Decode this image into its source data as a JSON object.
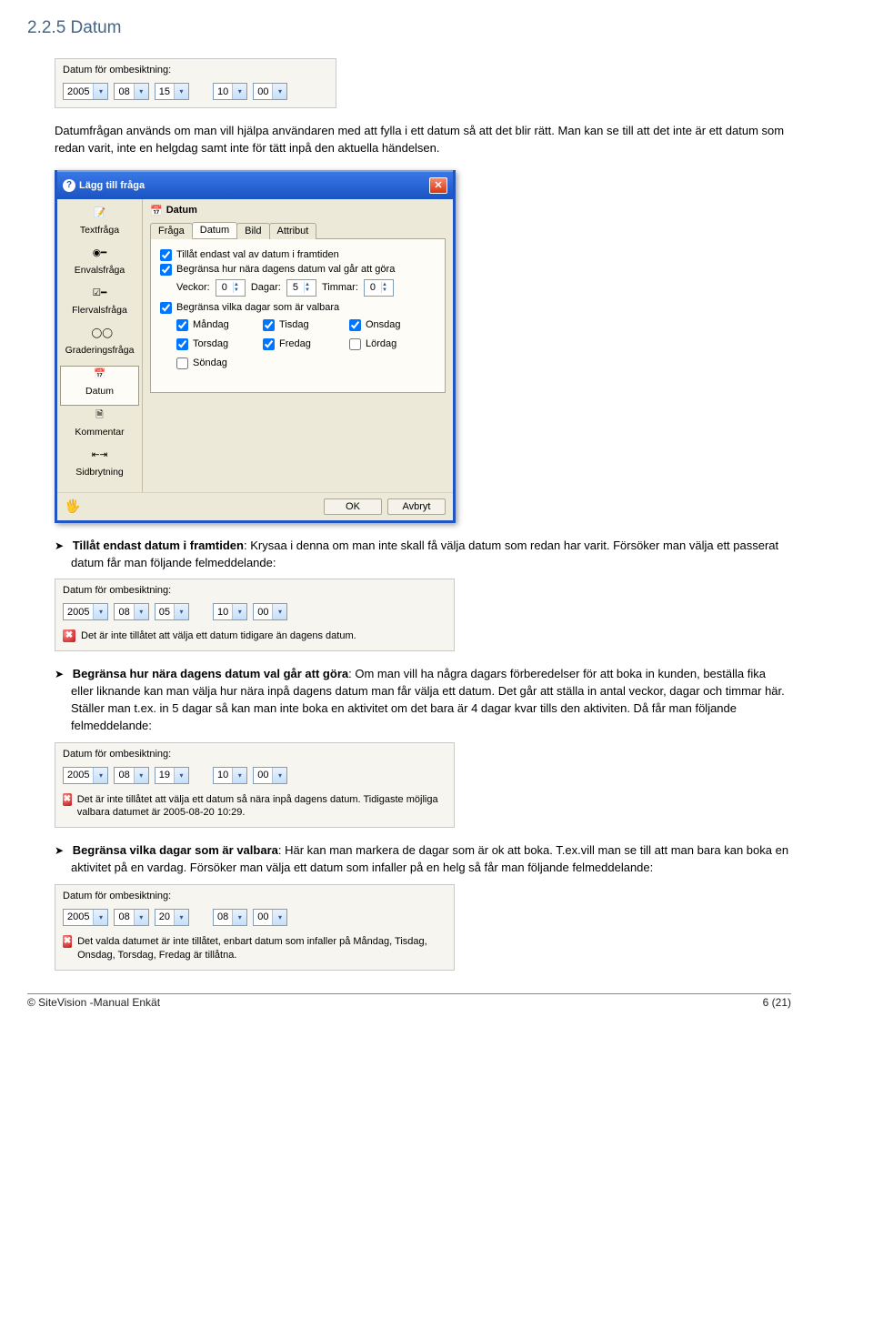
{
  "section": {
    "number": "2.2.5",
    "title": "Datum",
    "intro": "Datumfrågan används om man vill hjälpa användaren med att fylla i ett datum så att det blir rätt. Man kan se till att det inte är ett datum som redan varit, inte en helgdag samt inte för tätt inpå den aktuella händelsen."
  },
  "widget1": {
    "label": "Datum för ombesiktning:",
    "year": "2005",
    "month": "08",
    "day": "15",
    "hour": "10",
    "minute": "00"
  },
  "dialog": {
    "title": "Lägg till fråga",
    "sidebar": [
      {
        "label": "Textfråga"
      },
      {
        "label": "Envalsfråga"
      },
      {
        "label": "Flervalsfråga"
      },
      {
        "label": "Graderingsfråga"
      },
      {
        "label": "Datum"
      },
      {
        "label": "Kommentar"
      },
      {
        "label": "Sidbrytning"
      }
    ],
    "panelTitle": "Datum",
    "tabs": [
      "Fråga",
      "Datum",
      "Bild",
      "Attribut"
    ],
    "cb1": "Tillåt endast val av datum i framtiden",
    "cb2": "Begränsa hur nära dagens datum val går att göra",
    "weeksLbl": "Veckor:",
    "weeks": "0",
    "daysLbl": "Dagar:",
    "days": "5",
    "hoursLbl": "Timmar:",
    "hours": "0",
    "cb3": "Begränsa vilka dagar som är valbara",
    "dayNames": [
      "Måndag",
      "Tisdag",
      "Onsdag",
      "Torsdag",
      "Fredag",
      "Lördag",
      "Söndag"
    ],
    "dayChecked": [
      true,
      true,
      true,
      true,
      true,
      false,
      false
    ],
    "ok": "OK",
    "cancel": "Avbryt"
  },
  "bullets": {
    "b1": {
      "lead": "Tillåt endast datum i framtiden",
      "rest": ": Krysaa i denna om man inte skall få välja datum som redan har varit. Försöker man välja ett passerat datum får man följande felmeddelande:"
    },
    "b2": {
      "lead": "Begränsa hur nära dagens datum val går att göra",
      "rest": ": Om man vill ha några dagars förberedelser för att boka in kunden, beställa fika eller liknande kan man välja hur nära inpå dagens datum man får välja ett datum. Det går att ställa in antal veckor, dagar och timmar här. Ställer man t.ex. in 5 dagar så kan man inte boka en aktivitet om det bara är 4 dagar kvar tills den aktiviten. Då får man följande felmeddelande:"
    },
    "b3": {
      "lead": "Begränsa vilka dagar som är valbara",
      "rest": ": Här kan man markera de dagar som är ok att boka. T.ex.vill man se till att man bara kan boka en aktivitet på en vardag. Försöker man välja ett datum som infaller på en helg så får man följande felmeddelande:"
    }
  },
  "widget2": {
    "label": "Datum för ombesiktning:",
    "year": "2005",
    "month": "08",
    "day": "05",
    "hour": "10",
    "minute": "00",
    "error": "Det är inte tillåtet att välja ett datum tidigare än dagens datum."
  },
  "widget3": {
    "label": "Datum för ombesiktning:",
    "year": "2005",
    "month": "08",
    "day": "19",
    "hour": "10",
    "minute": "00",
    "error": "Det är inte tillåtet att välja ett datum så nära inpå dagens datum. Tidigaste möjliga valbara datumet är 2005-08-20 10:29."
  },
  "widget4": {
    "label": "Datum för ombesiktning:",
    "year": "2005",
    "month": "08",
    "day": "20",
    "hour": "08",
    "minute": "00",
    "error": "Det valda datumet är inte tillåtet, enbart datum som infaller på Måndag, Tisdag, Onsdag, Torsdag, Fredag är tillåtna."
  },
  "footer": {
    "left": "© SiteVision -Manual Enkät",
    "right": "6 (21)"
  }
}
